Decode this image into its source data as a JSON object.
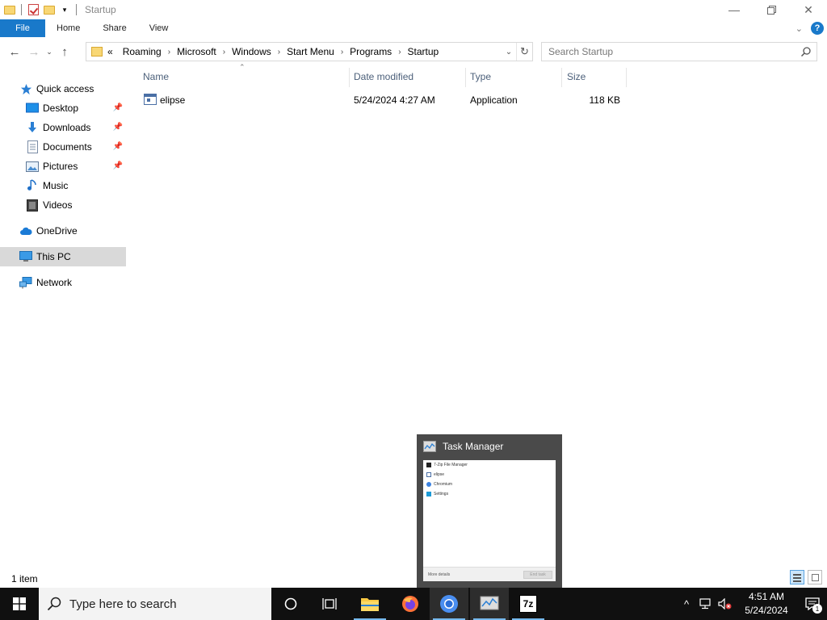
{
  "window": {
    "title": "Startup",
    "minimize_icon": "minimize-icon",
    "maximize_icon": "restore-icon",
    "close_icon": "close-icon"
  },
  "ribbon": {
    "tabs": [
      "File",
      "Home",
      "Share",
      "View"
    ]
  },
  "address": {
    "overflow": "«",
    "crumbs": [
      "Roaming",
      "Microsoft",
      "Windows",
      "Start Menu",
      "Programs",
      "Startup"
    ]
  },
  "search": {
    "placeholder": "Search Startup"
  },
  "nav": {
    "items": [
      {
        "label": "Quick access",
        "icon": "star-icon",
        "pinned": false
      },
      {
        "label": "Desktop",
        "icon": "desktop-icon",
        "pinned": true
      },
      {
        "label": "Downloads",
        "icon": "downloads-icon",
        "pinned": true
      },
      {
        "label": "Documents",
        "icon": "documents-icon",
        "pinned": true
      },
      {
        "label": "Pictures",
        "icon": "pictures-icon",
        "pinned": true
      },
      {
        "label": "Music",
        "icon": "music-icon",
        "pinned": false
      },
      {
        "label": "Videos",
        "icon": "videos-icon",
        "pinned": false
      },
      {
        "label": "OneDrive",
        "icon": "cloud-icon",
        "pinned": false
      },
      {
        "label": "This PC",
        "icon": "computer-icon",
        "pinned": false
      },
      {
        "label": "Network",
        "icon": "network-icon",
        "pinned": false
      }
    ],
    "selected": "This PC"
  },
  "columns": {
    "name": "Name",
    "date": "Date modified",
    "type": "Type",
    "size": "Size"
  },
  "files": [
    {
      "name": "elipse",
      "date": "5/24/2024 4:27 AM",
      "type": "Application",
      "size": "118 KB"
    }
  ],
  "status": {
    "count": "1 item"
  },
  "taskmanager_preview": {
    "title": "Task Manager",
    "rows": [
      "7-Zip File Manager",
      "elipse",
      "Chromium",
      "Settings"
    ],
    "more_details": "More details",
    "end_task": "End task"
  },
  "taskbar": {
    "search_placeholder": "Type here to search",
    "apps": [
      "cortana-icon",
      "task-view-icon",
      "file-explorer-icon",
      "firefox-icon",
      "chromium-icon",
      "task-manager-icon",
      "7zip-icon"
    ],
    "sevenzip_label": "7z",
    "clock_time": "4:51 AM",
    "clock_date": "5/24/2024",
    "notification_count": "1"
  },
  "colors": {
    "accent": "#1979ca",
    "taskbar": "#101010",
    "selected_nav": "#d9d9d9"
  }
}
